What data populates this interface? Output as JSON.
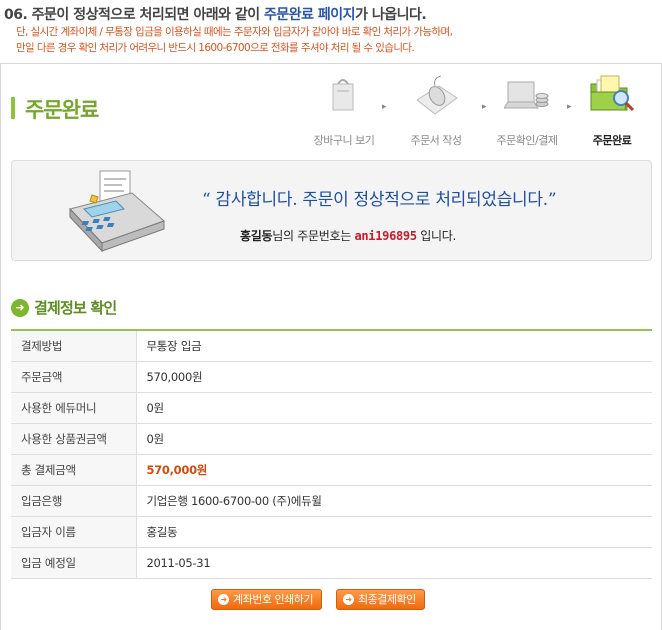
{
  "heading": {
    "prefix": "06. 주문이 정상적으로 처리되면 아래와 같이 ",
    "highlight": "주문완료 페이지",
    "suffix": "가 나옵니다."
  },
  "notice": {
    "line1": "단, 실시간 계좌이체 / 무통장 입금을 이용하실 때에는 주문자와 입금자가 같아야 바로 확인 처리가 가능하며,",
    "line2": "만일 다른 경우 확인 처리가 어려우니 반드시 1600-6700으로 전화를 주셔야 처리 될 수 있습니다."
  },
  "page_title": "주문완료",
  "steps": [
    {
      "label": "장바구니 보기",
      "icon": "cart-bag-icon",
      "active": false
    },
    {
      "label": "주문서 작성",
      "icon": "mouse-pad-icon",
      "active": false
    },
    {
      "label": "주문확인/결제",
      "icon": "laptop-coins-icon",
      "active": false
    },
    {
      "label": "주문완료",
      "icon": "folder-magnifier-icon",
      "active": true
    }
  ],
  "thanks": {
    "message": "“ 감사합니다. 주문이 정상적으로 처리되었습니다.”",
    "customer_name": "홍길동",
    "mid_text": "님의 주문번호는 ",
    "order_number": "ani196895",
    "end_text": " 입니다."
  },
  "payment_section": {
    "title": "결제정보 확인",
    "rows": [
      {
        "label": "결제방법",
        "value": "무통장 입금"
      },
      {
        "label": "주문금액",
        "value": "570,000원"
      },
      {
        "label": "사용한 에듀머니",
        "value": "0원"
      },
      {
        "label": "사용한 상품권금액",
        "value": "0원"
      },
      {
        "label": "총 결제금액",
        "value": "570,000원"
      },
      {
        "label": "입금은행",
        "value": "기업은행 1600-6700-00 (주)에듀윌"
      },
      {
        "label": "입금자 이름",
        "value": "홍길동"
      },
      {
        "label": "입금 예정일",
        "value": "2011-05-31"
      }
    ]
  },
  "buttons": {
    "print_account": "계좌번호 인쇄하기",
    "final_confirm": "최종결제확인"
  },
  "colors": {
    "accent_green": "#74a82a",
    "highlight_blue": "#2a56a8",
    "notice_orange": "#d9531e",
    "order_number_red": "#c21e2c",
    "button_orange": "#f06a0d"
  }
}
